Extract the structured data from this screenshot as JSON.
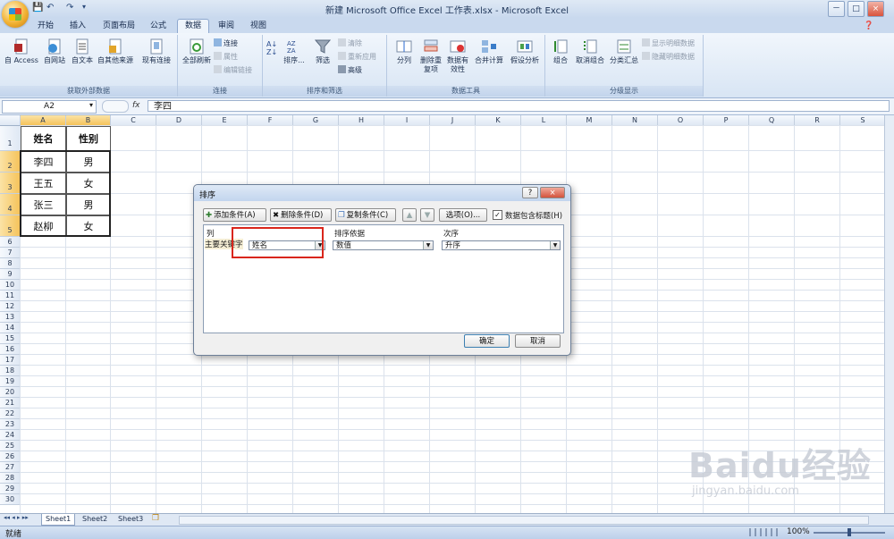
{
  "window": {
    "title": "新建 Microsoft Office Excel 工作表.xlsx - Microsoft Excel",
    "controls": [
      "－",
      "□",
      "×"
    ]
  },
  "tabs": [
    "开始",
    "插入",
    "页面布局",
    "公式",
    "数据",
    "审阅",
    "视图"
  ],
  "active_tab": "数据",
  "ribbon": {
    "get_external": {
      "label": "获取外部数据",
      "buttons": [
        "自 Access",
        "自网站",
        "自文本",
        "自其他来源",
        "现有连接"
      ]
    },
    "connections": {
      "label": "连接",
      "refresh_all": "全部刷新",
      "items": [
        "连接",
        "属性",
        "编辑链接"
      ]
    },
    "sort_filter": {
      "label": "排序和筛选",
      "sort": "排序...",
      "filter": "筛选",
      "items": [
        "清除",
        "重新应用",
        "高级"
      ]
    },
    "data_tools": {
      "label": "数据工具",
      "buttons": [
        "分列",
        "删除重复项",
        "数据有效性",
        "合并计算",
        "假设分析"
      ]
    },
    "outline": {
      "label": "分级显示",
      "buttons": [
        "组合",
        "取消组合",
        "分类汇总"
      ],
      "items": [
        "显示明细数据",
        "隐藏明细数据"
      ]
    }
  },
  "formula_bar": {
    "name_box": "A2",
    "fx": "fx",
    "value": "李四"
  },
  "columns": [
    "A",
    "B",
    "C",
    "D",
    "E",
    "F",
    "G",
    "H",
    "I",
    "J",
    "K",
    "L",
    "M",
    "N",
    "O",
    "P",
    "Q",
    "R",
    "S"
  ],
  "rows": [
    "1",
    "2",
    "3",
    "4",
    "5",
    "6",
    "7",
    "8",
    "9",
    "10",
    "11",
    "12",
    "13",
    "14",
    "15",
    "16",
    "17",
    "18",
    "19",
    "20",
    "21",
    "22",
    "23",
    "24",
    "25",
    "26",
    "27",
    "28",
    "29",
    "30"
  ],
  "table": {
    "headers": [
      "姓名",
      "性别"
    ],
    "rows": [
      [
        "李四",
        "男"
      ],
      [
        "王五",
        "女"
      ],
      [
        "张三",
        "男"
      ],
      [
        "赵柳",
        "女"
      ]
    ]
  },
  "sheets": [
    "Sheet1",
    "Sheet2",
    "Sheet3"
  ],
  "status": {
    "ready": "就绪",
    "zoom": "100%"
  },
  "dialog": {
    "title": "排序",
    "help": "?",
    "close": "×",
    "add": "添加条件(A)",
    "delete": "删除条件(D)",
    "copy": "复制条件(C)",
    "up": "▲",
    "down": "▼",
    "options": "选项(O)...",
    "has_header": "数据包含标题(H)",
    "has_header_checked": true,
    "col_header": "列",
    "sort_on_header": "排序依据",
    "order_header": "次序",
    "row_label": "主要关键字",
    "key_value": "姓名",
    "sort_on_value": "数值",
    "order_value": "升序",
    "ok": "确定",
    "cancel": "取消"
  },
  "watermark": {
    "brand": "Baidu经验",
    "url": "jingyan.baidu.com"
  },
  "colors": {
    "highlight": "#d9261c",
    "ribbon": "#d8e5f4",
    "selected_header": "#f5c35b"
  }
}
